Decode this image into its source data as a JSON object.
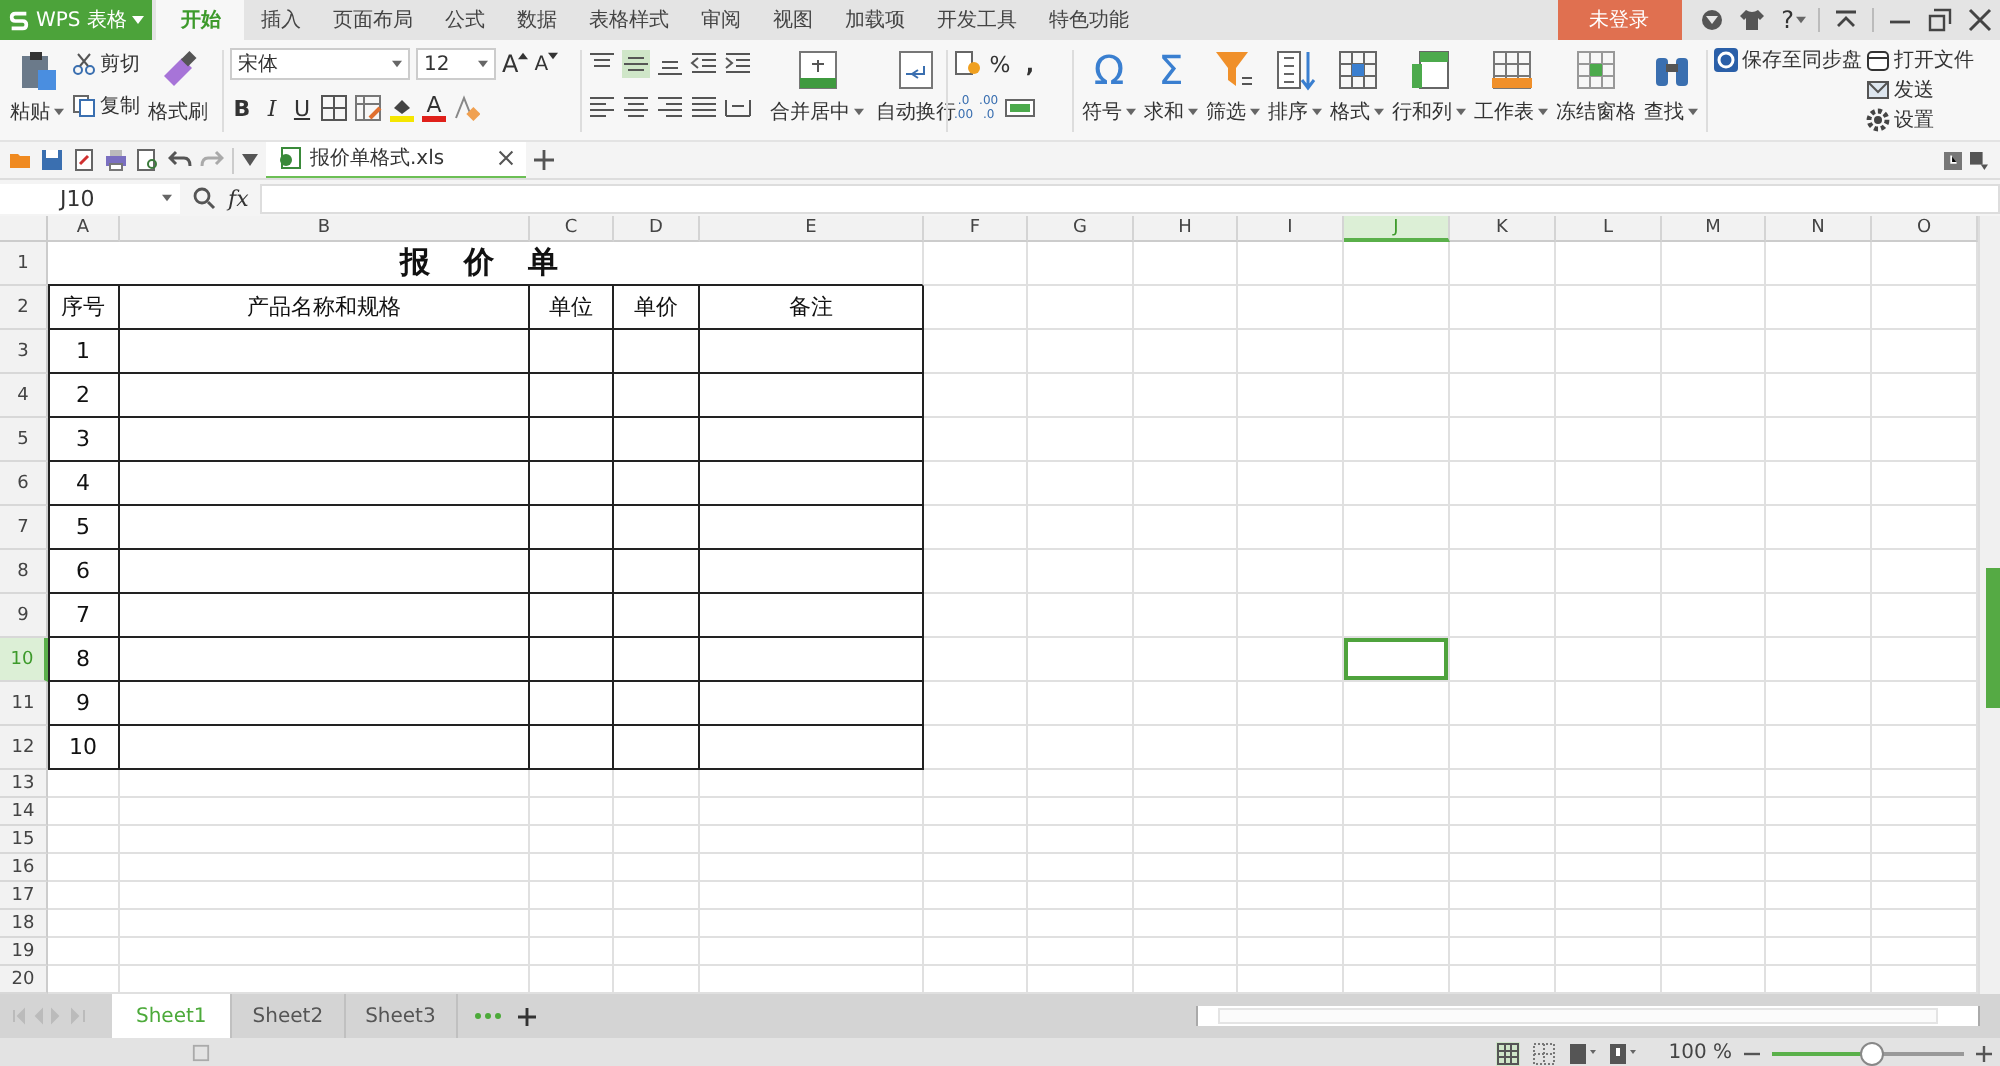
{
  "app_button": {
    "label": "WPS 表格"
  },
  "ribbon_tabs": [
    {
      "label": "开始",
      "selected": true
    },
    {
      "label": "插入",
      "selected": false
    },
    {
      "label": "页面布局",
      "selected": false
    },
    {
      "label": "公式",
      "selected": false
    },
    {
      "label": "数据",
      "selected": false
    },
    {
      "label": "表格样式",
      "selected": false
    },
    {
      "label": "审阅",
      "selected": false
    },
    {
      "label": "视图",
      "selected": false
    },
    {
      "label": "加载项",
      "selected": false
    },
    {
      "label": "开发工具",
      "selected": false
    },
    {
      "label": "特色功能",
      "selected": false
    }
  ],
  "login_button": "未登录",
  "help": "?",
  "clipboard": {
    "paste": "粘贴",
    "cut": "剪切",
    "copy": "复制",
    "painter": "格式刷"
  },
  "font": {
    "family": "宋体",
    "size": "12",
    "grow": "A",
    "shrink": "A",
    "bold": "B",
    "italic": "I",
    "underline": "U",
    "color_letter": "A"
  },
  "alignment": {
    "merge": "合并居中",
    "wrap": "自动换行"
  },
  "number": {
    "percent": "%",
    "comma": ",",
    "increase_decimal": [
      ".0",
      ".00"
    ],
    "decrease_decimal": [
      ".00",
      ".0"
    ]
  },
  "commands": [
    {
      "label": "符号",
      "kind": "glyph",
      "glyph": "Ω",
      "dropdown": true
    },
    {
      "label": "求和",
      "kind": "glyph",
      "glyph": "Σ",
      "dropdown": true
    },
    {
      "label": "筛选",
      "kind": "filter",
      "dropdown": true
    },
    {
      "label": "排序",
      "kind": "sort",
      "dropdown": true
    },
    {
      "label": "格式",
      "kind": "format",
      "dropdown": true
    },
    {
      "label": "行和列",
      "kind": "rowcol",
      "dropdown": true
    },
    {
      "label": "工作表",
      "kind": "sheet",
      "dropdown": true
    },
    {
      "label": "冻结窗格",
      "kind": "freeze",
      "dropdown": false
    },
    {
      "label": "查找",
      "kind": "find",
      "dropdown": true
    }
  ],
  "side_actions": [
    {
      "label": "保存至同步盘",
      "kind": "sync"
    },
    {
      "label": "打开文件",
      "kind": "open"
    },
    {
      "label": "发送",
      "kind": "mail"
    },
    {
      "label": "设置",
      "kind": "gear"
    }
  ],
  "document_tab": {
    "name": "报价单格式.xls"
  },
  "formula_bar": {
    "name_box": "J10",
    "fx": "fx"
  },
  "sheet": {
    "columns": [
      {
        "label": "A",
        "selected": false
      },
      {
        "label": "B",
        "selected": false
      },
      {
        "label": "C",
        "selected": false
      },
      {
        "label": "D",
        "selected": false
      },
      {
        "label": "E",
        "selected": false
      },
      {
        "label": "F",
        "selected": false
      },
      {
        "label": "G",
        "selected": false
      },
      {
        "label": "H",
        "selected": false
      },
      {
        "label": "I",
        "selected": false
      },
      {
        "label": "J",
        "selected": true
      },
      {
        "label": "K",
        "selected": false
      },
      {
        "label": "L",
        "selected": false
      },
      {
        "label": "M",
        "selected": false
      },
      {
        "label": "N",
        "selected": false
      },
      {
        "label": "O",
        "selected": false
      }
    ],
    "rows": [
      {
        "label": "1",
        "selected": false,
        "cells": [
          {
            "text": "报 价 单",
            "kind": "title"
          }
        ]
      },
      {
        "label": "2",
        "selected": false,
        "cells": [
          {
            "text": "序号",
            "kind": "boxed"
          },
          {
            "text": "产品名称和规格",
            "kind": "boxed"
          },
          {
            "text": "单位",
            "kind": "boxed"
          },
          {
            "text": "单价",
            "kind": "boxed"
          },
          {
            "text": "备注",
            "kind": "boxed"
          }
        ]
      },
      {
        "label": "3",
        "selected": false,
        "cells": [
          {
            "text": "1",
            "kind": "boxed"
          },
          {
            "kind": "boxed"
          },
          {
            "kind": "boxed"
          },
          {
            "kind": "boxed"
          },
          {
            "kind": "boxed"
          }
        ]
      },
      {
        "label": "4",
        "selected": false,
        "cells": [
          {
            "text": "2",
            "kind": "boxed"
          },
          {
            "kind": "boxed"
          },
          {
            "kind": "boxed"
          },
          {
            "kind": "boxed"
          },
          {
            "kind": "boxed"
          }
        ]
      },
      {
        "label": "5",
        "selected": false,
        "cells": [
          {
            "text": "3",
            "kind": "boxed"
          },
          {
            "kind": "boxed"
          },
          {
            "kind": "boxed"
          },
          {
            "kind": "boxed"
          },
          {
            "kind": "boxed"
          }
        ]
      },
      {
        "label": "6",
        "selected": false,
        "cells": [
          {
            "text": "4",
            "kind": "boxed"
          },
          {
            "kind": "boxed"
          },
          {
            "kind": "boxed"
          },
          {
            "kind": "boxed"
          },
          {
            "kind": "boxed"
          }
        ]
      },
      {
        "label": "7",
        "selected": false,
        "cells": [
          {
            "text": "5",
            "kind": "boxed"
          },
          {
            "kind": "boxed"
          },
          {
            "kind": "boxed"
          },
          {
            "kind": "boxed"
          },
          {
            "kind": "boxed"
          }
        ]
      },
      {
        "label": "8",
        "selected": false,
        "cells": [
          {
            "text": "6",
            "kind": "boxed"
          },
          {
            "kind": "boxed"
          },
          {
            "kind": "boxed"
          },
          {
            "kind": "boxed"
          },
          {
            "kind": "boxed"
          }
        ]
      },
      {
        "label": "9",
        "selected": false,
        "cells": [
          {
            "text": "7",
            "kind": "boxed"
          },
          {
            "kind": "boxed"
          },
          {
            "kind": "boxed"
          },
          {
            "kind": "boxed"
          },
          {
            "kind": "boxed"
          }
        ]
      },
      {
        "label": "10",
        "selected": true,
        "cells": [
          {
            "text": "8",
            "kind": "boxed"
          },
          {
            "kind": "boxed"
          },
          {
            "kind": "boxed"
          },
          {
            "kind": "boxed"
          },
          {
            "kind": "boxed"
          }
        ]
      },
      {
        "label": "11",
        "selected": false,
        "cells": [
          {
            "text": "9",
            "kind": "boxed"
          },
          {
            "kind": "boxed"
          },
          {
            "kind": "boxed"
          },
          {
            "kind": "boxed"
          },
          {
            "kind": "boxed"
          }
        ]
      },
      {
        "label": "12",
        "selected": false,
        "cells": [
          {
            "text": "10",
            "kind": "boxed"
          },
          {
            "kind": "boxed"
          },
          {
            "kind": "boxed"
          },
          {
            "kind": "boxed"
          },
          {
            "kind": "boxed"
          }
        ]
      },
      {
        "label": "13",
        "selected": false
      },
      {
        "label": "14",
        "selected": false
      },
      {
        "label": "15",
        "selected": false
      },
      {
        "label": "16",
        "selected": false
      },
      {
        "label": "17",
        "selected": false
      },
      {
        "label": "18",
        "selected": false
      },
      {
        "label": "19",
        "selected": false
      },
      {
        "label": "20",
        "selected": false
      }
    ]
  },
  "sheet_tabs": [
    {
      "label": "Sheet1",
      "selected": true
    },
    {
      "label": "Sheet2",
      "selected": false
    },
    {
      "label": "Sheet3",
      "selected": false
    }
  ],
  "zoom": {
    "reading": "100 %",
    "level": 0.52
  }
}
